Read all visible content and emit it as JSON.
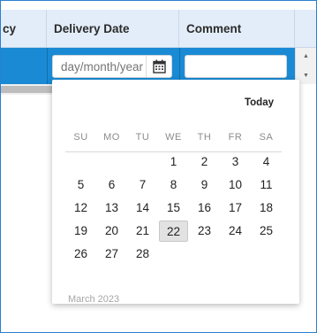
{
  "columns": {
    "currency": "cy",
    "delivery": "Delivery Date",
    "comment": "Comment"
  },
  "row": {
    "date_placeholder": "day/month/year",
    "comment_value": ""
  },
  "picker": {
    "today_label": "Today",
    "weekdays": [
      "SU",
      "MO",
      "TU",
      "WE",
      "TH",
      "FR",
      "SA"
    ],
    "weeks": [
      [
        "",
        "",
        "",
        "1",
        "2",
        "3",
        "4"
      ],
      [
        "5",
        "6",
        "7",
        "8",
        "9",
        "10",
        "11"
      ],
      [
        "12",
        "13",
        "14",
        "15",
        "16",
        "17",
        "18"
      ],
      [
        "19",
        "20",
        "21",
        "22",
        "23",
        "24",
        "25"
      ],
      [
        "26",
        "27",
        "28",
        "",
        "",
        "",
        ""
      ]
    ],
    "highlighted_day": "22",
    "month_label": "March 2023"
  },
  "colors": {
    "selected_row": "#1a8ad4",
    "header_bg": "#e3edf9",
    "frame_border": "#2a7fd0",
    "today_bg": "#e2e2e2"
  },
  "icons": {
    "calendar": "calendar-icon",
    "scroll_up": "scroll-up-arrow-icon",
    "scroll_down": "scroll-down-arrow-icon"
  }
}
